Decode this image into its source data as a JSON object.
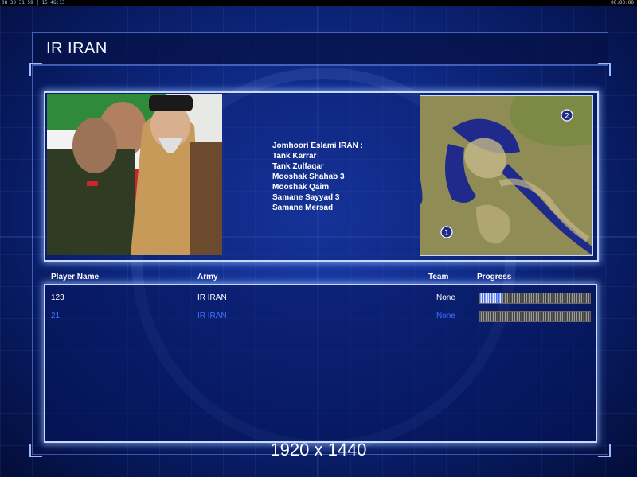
{
  "status_bar": {
    "left_text": "08 30 31 59 | 15:46:13",
    "right_text": "00:00:00"
  },
  "title": "IR IRAN",
  "description": {
    "header": "Jomhoori Eslami IRAN :",
    "units": [
      "Tank Karrar",
      "Tank Zulfaqar",
      "Mooshak Shahab 3",
      "Mooshak Qaim",
      "Samane Sayyad 3",
      "Samane Mersad"
    ]
  },
  "minimap": {
    "markers": [
      "1",
      "2"
    ]
  },
  "columns": {
    "player_name": "Player Name",
    "army": "Army",
    "team": "Team",
    "progress": "Progress"
  },
  "players": [
    {
      "name": "123",
      "army": "IR IRAN",
      "team": "None",
      "progress": 0.2,
      "highlight": "self"
    },
    {
      "name": "21",
      "army": "IR IRAN",
      "team": "None",
      "progress": 0.0,
      "highlight": "other"
    }
  ],
  "resolution_label": "1920 x 1440",
  "colors": {
    "background": "#0f2a86",
    "self_text": "#ffffff",
    "other_text": "#3f6fff",
    "panel_border": "#c9d8ff"
  }
}
